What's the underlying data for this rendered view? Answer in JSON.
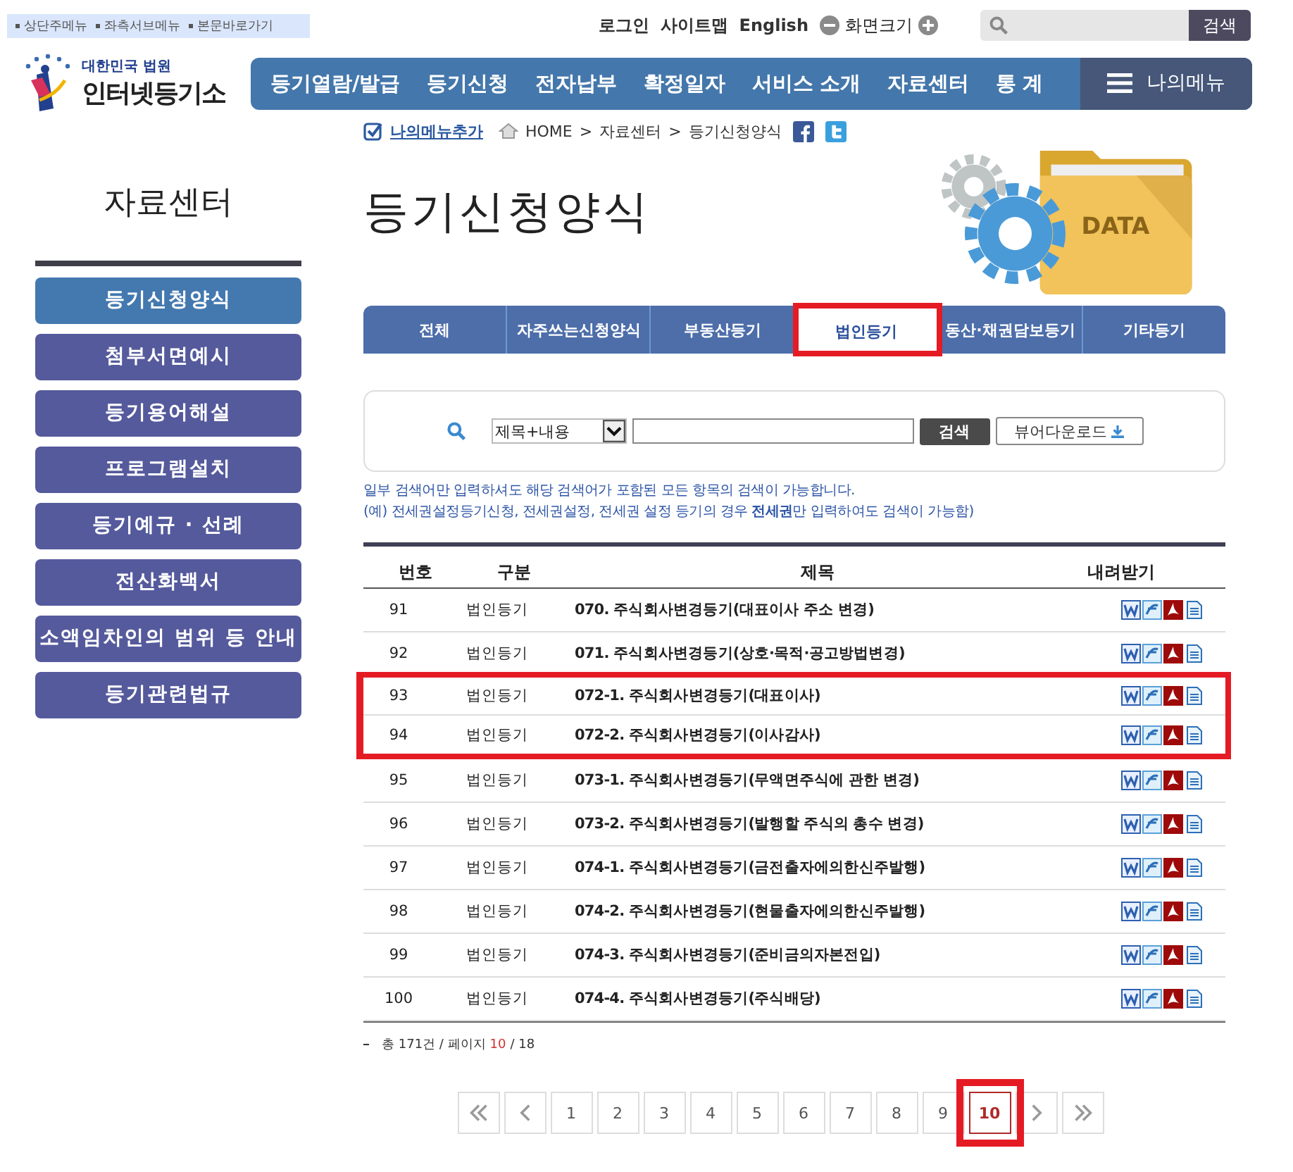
{
  "skip_links": [
    "상단주메뉴",
    "좌측서브메뉴",
    "본문바로가기"
  ],
  "utility_links": [
    "로그인",
    "사이트맵",
    "English"
  ],
  "font_size_label": "화면크기",
  "top_search": {
    "button": "검색"
  },
  "logo": {
    "subtitle": "대한민국 법원",
    "title": "인터넷등기소"
  },
  "nav": [
    "등기열람/발급",
    "등기신청",
    "전자납부",
    "확정일자",
    "서비스 소개",
    "자료센터",
    "통 계"
  ],
  "my_menu": "나의메뉴",
  "breadcrumb": {
    "add_link": "나의메뉴추가",
    "items": [
      "HOME",
      ">",
      "자료센터",
      ">",
      "등기신청양식"
    ]
  },
  "sidebar": {
    "title": "자료센터",
    "items": [
      {
        "label": "등기신청양식",
        "selected": true
      },
      {
        "label": "첨부서면예시",
        "selected": false
      },
      {
        "label": "등기용어해설",
        "selected": false
      },
      {
        "label": "프로그램설치",
        "selected": false
      },
      {
        "label": "등기예규 · 선례",
        "selected": false
      },
      {
        "label": "전산화백서",
        "selected": false
      },
      {
        "label": "소액임차인의 범위 등 안내",
        "selected": false
      },
      {
        "label": "등기관련법규",
        "selected": false
      }
    ]
  },
  "page_title": "등기신청양식",
  "illustration_label": "DATA",
  "tabs": [
    {
      "label": "전체",
      "selected": false,
      "highlighted": false
    },
    {
      "label": "자주쓰는신청양식",
      "selected": false,
      "highlighted": false
    },
    {
      "label": "부동산등기",
      "selected": false,
      "highlighted": false
    },
    {
      "label": "법인등기",
      "selected": true,
      "highlighted": true
    },
    {
      "label": "동산·채권담보등기",
      "selected": false,
      "highlighted": false
    },
    {
      "label": "기타등기",
      "selected": false,
      "highlighted": false
    }
  ],
  "search": {
    "select_value": "제목+내용",
    "button": "검색",
    "download_button": "뷰어다운로드"
  },
  "info": [
    "일부 검색어만 입력하셔도 해당 검색어가 포함된 모든 항목의 검색이 가능합니다.",
    "(예) 전세권설정등기신청, 전세권설정, 전세권 설정 등기의 경우 **전세권**만 입력하여도 검색이 가능함)"
  ],
  "table": {
    "columns": [
      "번호",
      "구분",
      "제목",
      "내려받기"
    ],
    "rows": [
      {
        "number": "91",
        "category": "법인등기",
        "title": "070. 주식회사변경등기(대표이사 주소 변경)",
        "highlighted": false
      },
      {
        "number": "92",
        "category": "법인등기",
        "title": "071. 주식회사변경등기(상호·목적·공고방법변경)",
        "highlighted": false
      },
      {
        "number": "93",
        "category": "법인등기",
        "title": "072-1. 주식회사변경등기(대표이사)",
        "highlighted": true
      },
      {
        "number": "94",
        "category": "법인등기",
        "title": "072-2. 주식회사변경등기(이사감사)",
        "highlighted": true
      },
      {
        "number": "95",
        "category": "법인등기",
        "title": "073-1. 주식회사변경등기(무액면주식에 관한 변경)",
        "highlighted": false
      },
      {
        "number": "96",
        "category": "법인등기",
        "title": "073-2. 주식회사변경등기(발행할 주식의 총수 변경)",
        "highlighted": false
      },
      {
        "number": "97",
        "category": "법인등기",
        "title": "074-1. 주식회사변경등기(금전출자에의한신주발행)",
        "highlighted": false
      },
      {
        "number": "98",
        "category": "법인등기",
        "title": "074-2. 주식회사변경등기(현물출자에의한신주발행)",
        "highlighted": false
      },
      {
        "number": "99",
        "category": "법인등기",
        "title": "074-3. 주식회사변경등기(준비금의자본전입)",
        "highlighted": false
      },
      {
        "number": "100",
        "category": "법인등기",
        "title": "074-4. 주식회사변경등기(주식배당)",
        "highlighted": false
      }
    ]
  },
  "summary": {
    "total": "총 171건 / 페이지",
    "current": "10",
    "pages": "/ 18"
  },
  "pagination": [
    {
      "label": "1",
      "selected": false,
      "highlighted": false
    },
    {
      "label": "2",
      "selected": false,
      "highlighted": false
    },
    {
      "label": "3",
      "selected": false,
      "highlighted": false
    },
    {
      "label": "4",
      "selected": false,
      "highlighted": false
    },
    {
      "label": "5",
      "selected": false,
      "highlighted": false
    },
    {
      "label": "6",
      "selected": false,
      "highlighted": false
    },
    {
      "label": "7",
      "selected": false,
      "highlighted": false
    },
    {
      "label": "8",
      "selected": false,
      "highlighted": false
    },
    {
      "label": "9",
      "selected": false,
      "highlighted": false
    },
    {
      "label": "10",
      "selected": true,
      "highlighted": true
    }
  ]
}
